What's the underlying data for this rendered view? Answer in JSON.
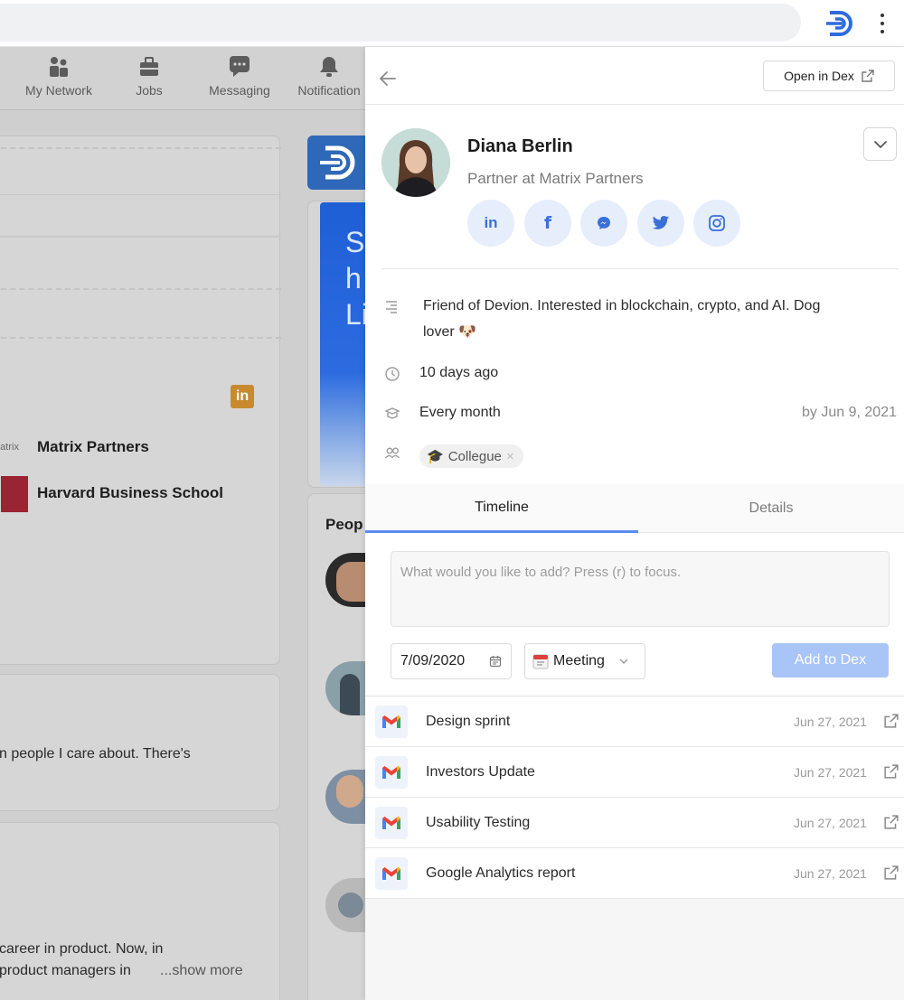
{
  "browser": {
    "extension_icon": "dex-logo-icon",
    "menu_icon": "kebab-menu-icon"
  },
  "linkedin_nav": {
    "items": [
      {
        "label": "My Network",
        "icon": "people-icon"
      },
      {
        "label": "Jobs",
        "icon": "briefcase-icon"
      },
      {
        "label": "Messaging",
        "icon": "chat-bubble-icon"
      },
      {
        "label": "Notification",
        "icon": "bell-icon"
      }
    ]
  },
  "linkedin_bg": {
    "company_1": "Matrix Partners",
    "company_1_logo_text": "matrix",
    "company_2": "Harvard Business School",
    "post_snippet": "n people I care about. There's",
    "about_line_1": "career in product. Now, in",
    "about_line_2": "product managers in",
    "show_more": "...show more",
    "people_heading": "Peop",
    "ad_letters": [
      "S",
      "h",
      "Li"
    ]
  },
  "panel": {
    "open_in_dex_label": "Open in Dex",
    "contact": {
      "name": "Diana Berlin",
      "title": "Partner at Matrix Partners"
    },
    "socials": [
      "linkedin-icon",
      "facebook-icon",
      "messenger-icon",
      "twitter-icon",
      "instagram-icon"
    ],
    "description_line_1": "Friend of Devion.  Interested in blockchain, crypto, and AI. Dog",
    "description_line_2": "lover 🐶",
    "last_contact": "10 days ago",
    "frequency": "Every month",
    "frequency_due": "by Jun 9, 2021",
    "tag_label": "Collegue",
    "tag_emoji": "🎓",
    "tabs": [
      {
        "label": "Timeline",
        "active": true
      },
      {
        "label": "Details",
        "active": false
      }
    ],
    "note_placeholder": "What would you like to add? Press (r) to focus.",
    "date_value": "7/09/2020",
    "type_value": "Meeting",
    "add_button_label": "Add to Dex",
    "timeline": [
      {
        "title": "Design sprint",
        "date": "Jun 27, 2021",
        "icon": "gmail-icon"
      },
      {
        "title": "Investors Update",
        "date": "Jun 27, 2021",
        "icon": "gmail-icon"
      },
      {
        "title": "Usability Testing",
        "date": "Jun 27, 2021",
        "icon": "gmail-icon"
      },
      {
        "title": "Google Analytics report",
        "date": "Jun 27, 2021",
        "icon": "gmail-icon"
      }
    ]
  },
  "colors": {
    "accent": "#5b8def",
    "add_button_disabled": "#a9c5f7",
    "social_bg": "#e6eefc",
    "social_icon": "#3b6fd8"
  }
}
